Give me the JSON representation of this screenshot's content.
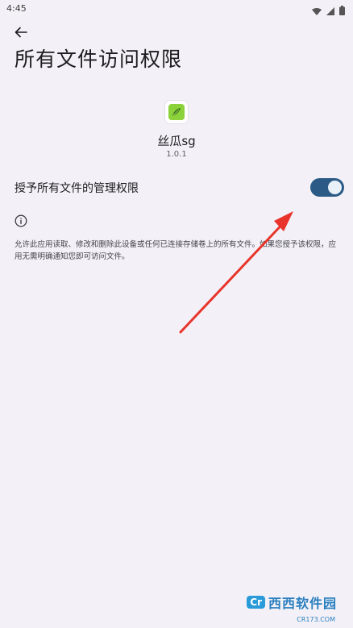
{
  "status_bar": {
    "time": "4:45",
    "icons": [
      "wifi-icon",
      "signal-icon",
      "battery-icon"
    ]
  },
  "page": {
    "title": "所有文件访问权限"
  },
  "app": {
    "name": "丝瓜sg",
    "version": "1.0.1",
    "icon": "app-icon"
  },
  "permission": {
    "label": "授予所有文件的管理权限",
    "enabled": true
  },
  "info": {
    "description": "允许此应用读取、修改和删除此设备或任何已连接存储卷上的所有文件。如果您授予该权限，应用无需明确通知您即可访问文件。"
  },
  "watermark": {
    "badge": "Cr",
    "text": "西西软件园",
    "url": "CR173.COM"
  },
  "colors": {
    "background": "#f3f1f7",
    "toggle_track": "#2b5a86",
    "annotation_arrow": "#e8342a"
  }
}
